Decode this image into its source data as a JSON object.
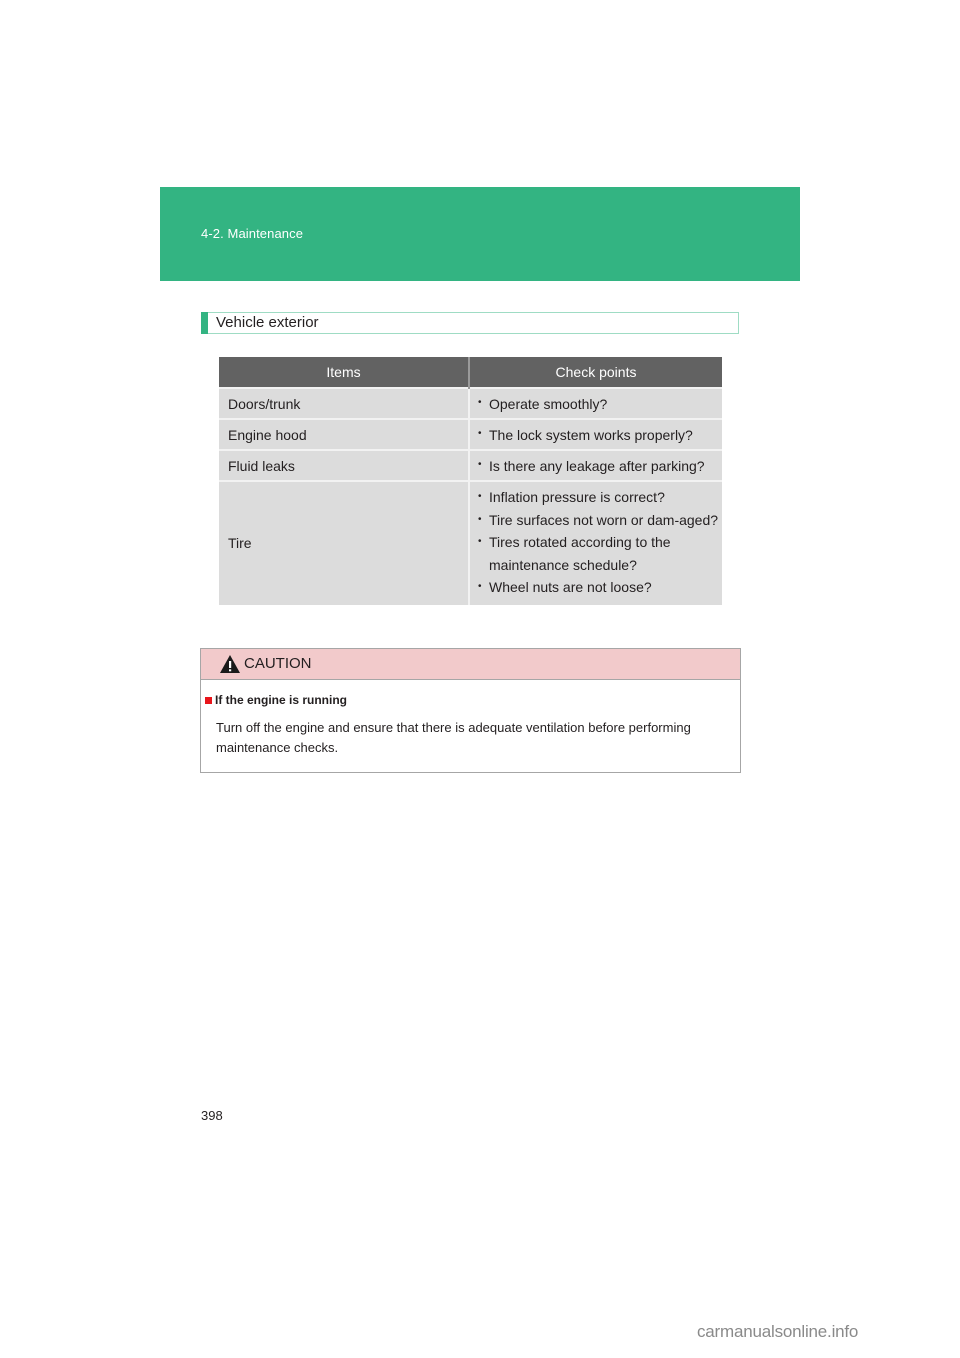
{
  "header": {
    "section_label": "4-2. Maintenance",
    "band_color": "#33b482"
  },
  "subsection": {
    "title": "Vehicle exterior"
  },
  "table": {
    "columns": [
      "Items",
      "Check points"
    ],
    "rows": [
      {
        "item": "Doors/trunk",
        "checks": [
          "Operate smoothly?"
        ]
      },
      {
        "item": "Engine hood",
        "checks": [
          "The lock system works properly?"
        ]
      },
      {
        "item": "Fluid leaks",
        "checks": [
          "Is there any leakage after parking?"
        ]
      },
      {
        "item": "Tire",
        "checks": [
          "Inflation pressure is correct?",
          "Tire surfaces not worn or dam-aged?",
          "Tires rotated according to the maintenance schedule?",
          "Wheel nuts are not loose?"
        ]
      }
    ]
  },
  "caution": {
    "icon": "warning-triangle-icon",
    "title": "CAUTION",
    "subheading": "If the engine is running",
    "body": "Turn off the engine and ensure that there is adequate ventilation before performing maintenance checks.",
    "header_color": "#f2cacb",
    "marker_color": "#e8151b"
  },
  "footer": {
    "page_number": "398",
    "watermark": "carmanualsonline.info"
  }
}
